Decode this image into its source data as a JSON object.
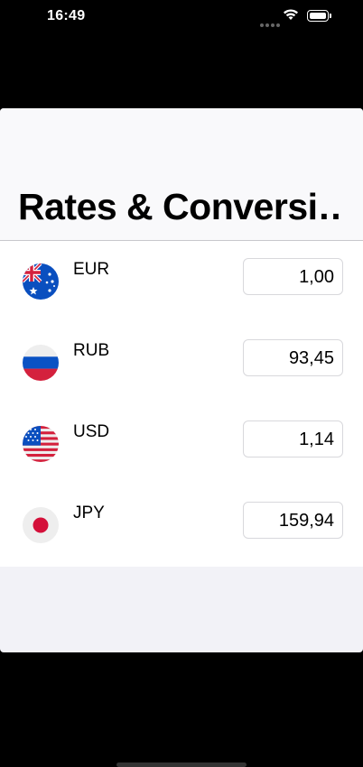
{
  "status_bar": {
    "time": "16:49"
  },
  "header": {
    "title": "Rates & Conversi…"
  },
  "currencies": [
    {
      "code": "EUR",
      "rate": "1,00",
      "flag": "australia-flag"
    },
    {
      "code": "RUB",
      "rate": "93,45",
      "flag": "russia-flag"
    },
    {
      "code": "USD",
      "rate": "1,14",
      "flag": "usa-flag"
    },
    {
      "code": "JPY",
      "rate": "159,94",
      "flag": "japan-flag"
    }
  ],
  "colors": {
    "sheet_background": "#f2f2f7",
    "header_background": "#f9f9fb",
    "list_background": "#ffffff",
    "field_border": "#d8d8dc"
  }
}
